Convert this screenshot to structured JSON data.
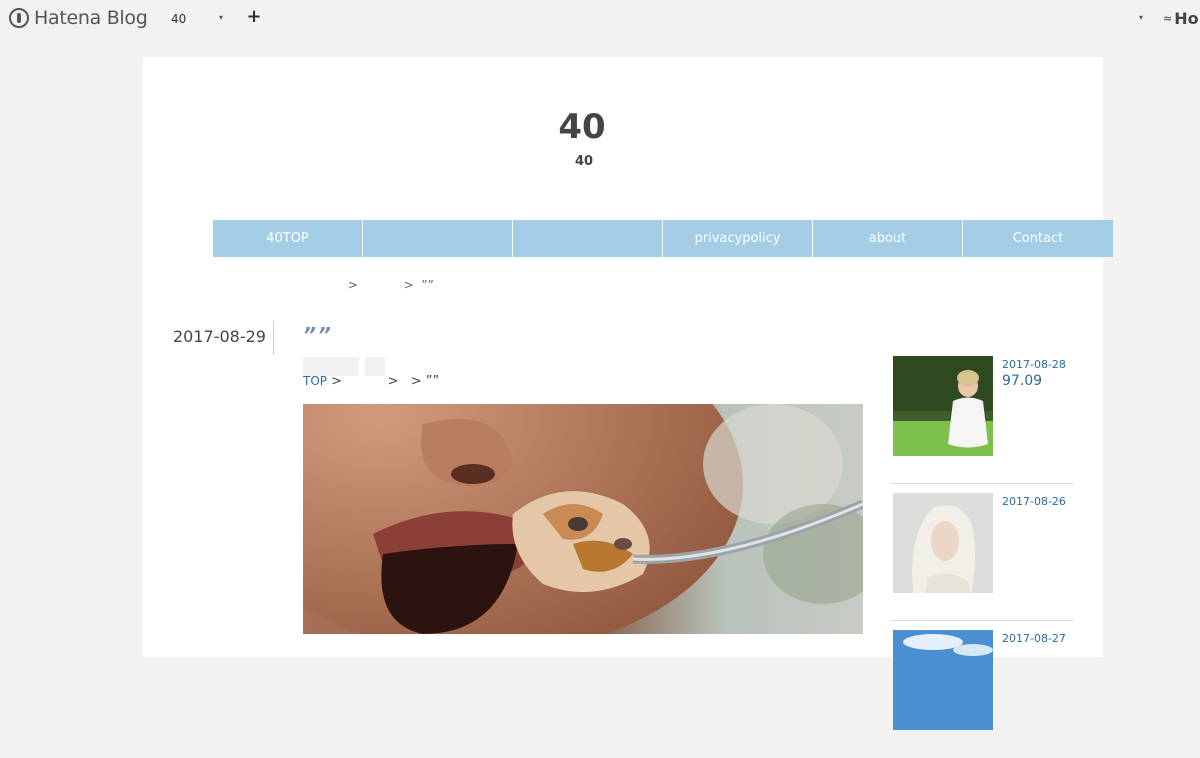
{
  "topbar": {
    "brand": "Hatena Blog",
    "blog_select_value": "40",
    "add_label": "+",
    "dropdown_caret": "▾",
    "hatena_logo_text": "Ho"
  },
  "header": {
    "title": "40",
    "description": "40"
  },
  "nav": {
    "items": [
      {
        "label": "40TOP"
      },
      {
        "label": ""
      },
      {
        "label": ""
      },
      {
        "label": "privacypolicy"
      },
      {
        "label": "about"
      },
      {
        "label": "Contact"
      }
    ]
  },
  "breadcrumb_top": "                 >            >  ””",
  "article": {
    "date": "2017-08-29",
    "title": "””",
    "crumb_link": "TOP",
    "crumb_rest": " >           >   > ””"
  },
  "sidebar": {
    "items": [
      {
        "date": "2017-08-28",
        "title": "97.09"
      },
      {
        "date": "2017-08-26",
        "title": ""
      },
      {
        "date": "2017-08-27",
        "title": ""
      }
    ]
  },
  "colors": {
    "nav_bg": "#a3cde6",
    "link": "#2a6aa0",
    "title_accent": "#6b8fb1",
    "page_bg": "#f2f2f2"
  }
}
